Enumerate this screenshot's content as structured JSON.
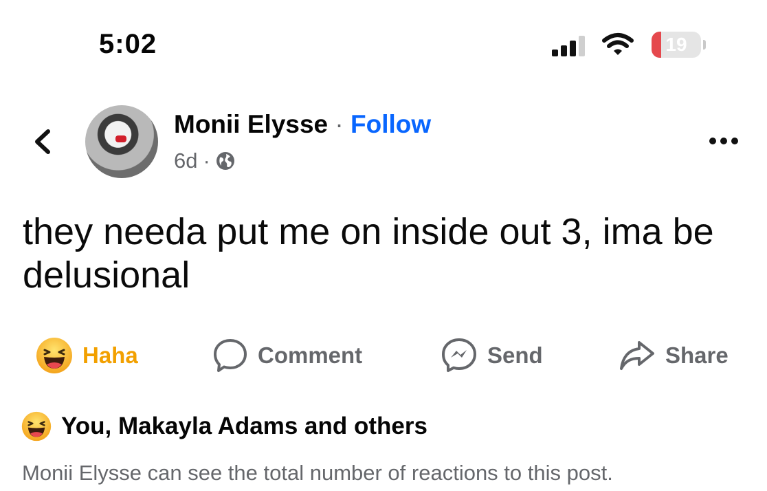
{
  "status_bar": {
    "time": "5:02",
    "battery_level": "19",
    "battery_color": "#e5484d",
    "signal_icon": "cellular-signal-icon",
    "wifi_icon": "wifi-icon"
  },
  "header": {
    "back_icon": "chevron-left-icon",
    "author": "Monii Elysse",
    "separator": "·",
    "follow_label": "Follow",
    "time_ago": "6d",
    "meta_separator": "·",
    "audience_icon": "globe-icon",
    "more_icon": "more-horizontal-icon"
  },
  "post": {
    "text": "they needa put me on inside out 3, ima be delusional"
  },
  "actions": [
    {
      "label": "Haha",
      "icon": "haha-emoji-icon",
      "color": "#f2a000"
    },
    {
      "label": "Comment",
      "icon": "comment-icon"
    },
    {
      "label": "Send",
      "icon": "messenger-icon"
    },
    {
      "label": "Share",
      "icon": "share-icon"
    }
  ],
  "reactions": {
    "icon": "haha-emoji-icon",
    "summary": "You, Makayla Adams and others",
    "note": "Monii Elysse can see the total number of reactions to this post."
  },
  "colors": {
    "link_blue": "#0866ff",
    "secondary_text": "#65676b",
    "haha_yellow": "#f2a000"
  }
}
